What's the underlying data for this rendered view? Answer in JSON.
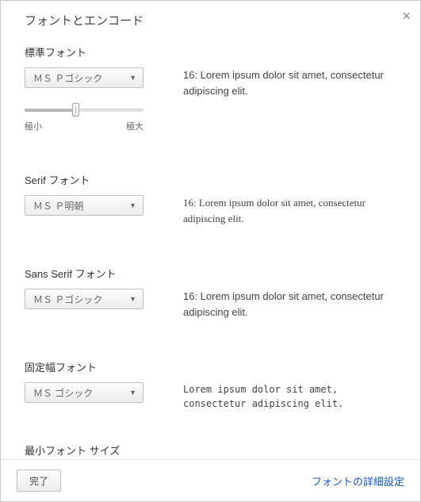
{
  "dialog": {
    "title": "フォントとエンコード",
    "close_label": "×"
  },
  "sections": {
    "standard": {
      "title": "標準フォント",
      "select_value": "ＭＳ Ｐゴシック",
      "preview": "16: Lorem ipsum dolor sit amet, consectetur adipiscing elit.",
      "slider": {
        "min_label": "極小",
        "max_label": "極大"
      }
    },
    "serif": {
      "title": "Serif フォント",
      "select_value": "ＭＳ Ｐ明朝",
      "preview": "16: Lorem ipsum dolor sit amet, consectetur adipiscing elit."
    },
    "sans": {
      "title": "Sans Serif フォント",
      "select_value": "ＭＳ Ｐゴシック",
      "preview": "16: Lorem ipsum dolor sit amet, consectetur adipiscing elit."
    },
    "fixed": {
      "title": "固定幅フォント",
      "select_value": "ＭＳ ゴシック",
      "preview": "Lorem ipsum dolor sit amet, consectetur adipiscing elit."
    },
    "minsize": {
      "title_partial": "最小フォント サイズ"
    }
  },
  "footer": {
    "done": "完了",
    "advanced_link": "フォントの詳細設定"
  }
}
